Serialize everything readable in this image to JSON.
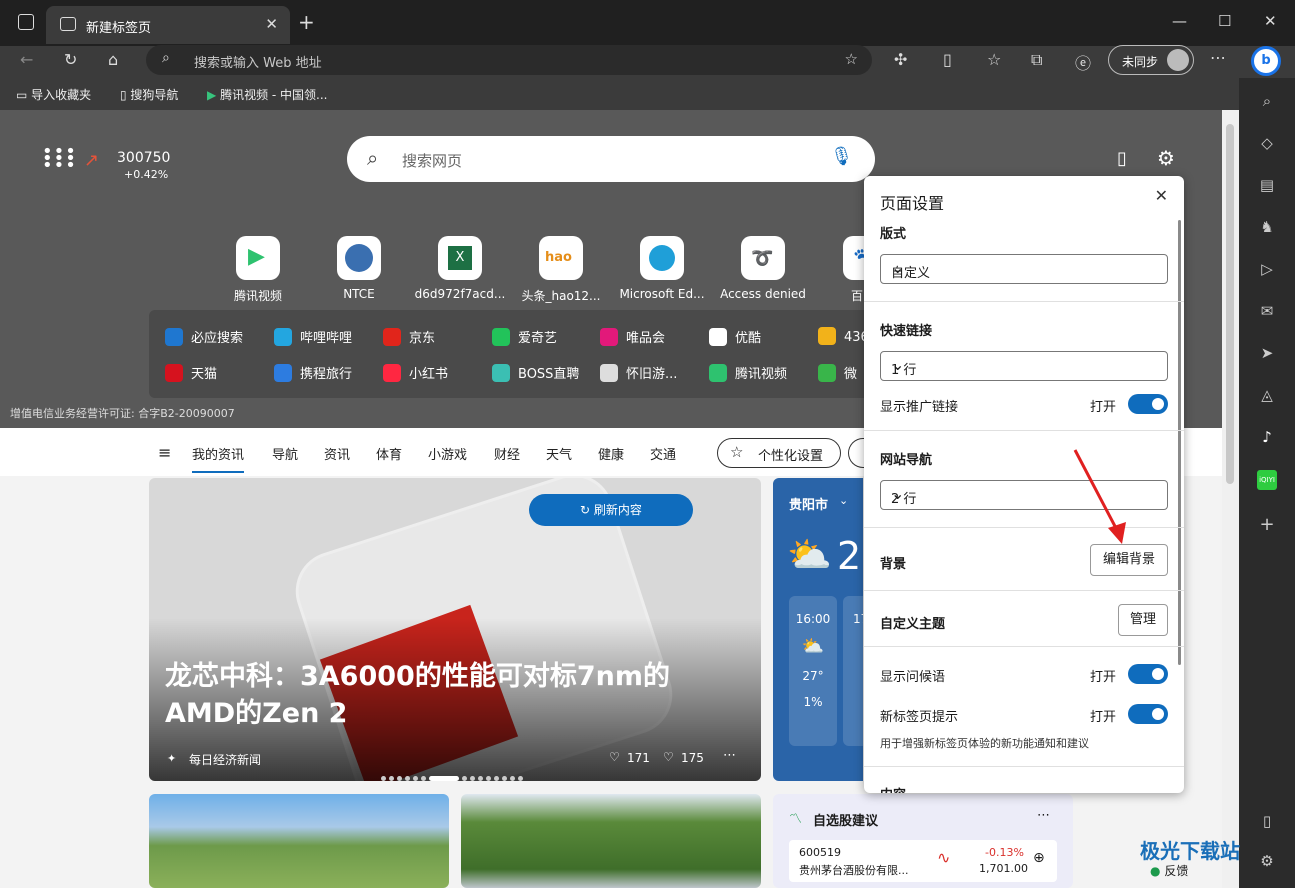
{
  "browser": {
    "tab_title": "新建标签页",
    "address_placeholder": "搜索或输入 Web 地址",
    "sync_label": "未同步",
    "bookmarks": [
      "导入收藏夹",
      "搜狗导航",
      "腾讯视频 - 中国领..."
    ]
  },
  "newtab": {
    "stock_value": "300750",
    "stock_change": "+0.42%",
    "search_placeholder": "搜索网页",
    "tiles": [
      "腾讯视频",
      "NTCE",
      "d6d972f7acd...",
      "头条_hao12...",
      "Microsoft Ed...",
      "Access denied",
      "百"
    ],
    "quick_links_row1": [
      "必应搜索",
      "哔哩哔哩",
      "京东",
      "爱奇艺",
      "唯品会",
      "优酷",
      "436"
    ],
    "quick_links_row2": [
      "天猫",
      "携程旅行",
      "小红书",
      "BOSS直聘",
      "怀旧游...",
      "腾讯视频",
      "微"
    ],
    "license": "增值电信业务经营许可证: 合字B2-20090007",
    "nav_items": [
      "我的资讯",
      "导航",
      "资讯",
      "体育",
      "小游戏",
      "财经",
      "天气",
      "健康",
      "交通"
    ],
    "personalize": "个性化设置",
    "refresh": "刷新内容",
    "headline": "龙芯中科：3A6000的性能可对标7nm的AMD的Zen 2",
    "source": "每日经济新闻",
    "likes": "171",
    "dislikes": "175",
    "weather_city": "贵阳市",
    "weather_temp": "2",
    "weather_time1": "16:00",
    "weather_time2": "17",
    "weather_t1": "27°",
    "weather_p1": "1%",
    "stock_card_title": "自选股建议",
    "stock_code": "600519",
    "stock_name": "贵州茅台酒股份有限...",
    "stock_pct": "-0.13%",
    "stock_price": "1,701.00",
    "feedback": "反馈"
  },
  "panel": {
    "title": "页面设置",
    "layout_label": "版式",
    "layout_value": "自定义",
    "quicklinks_label": "快速链接",
    "quicklinks_value": "1 行",
    "promo_label": "显示推广链接",
    "on": "打开",
    "sitenav_label": "网站导航",
    "sitenav_value": "2 行",
    "bg_label": "背景",
    "bg_button": "编辑背景",
    "theme_label": "自定义主题",
    "theme_button": "管理",
    "greeting_label": "显示问候语",
    "tips_label": "新标签页提示",
    "tips_note": "用于增强新标签页体验的新功能通知和建议",
    "content_label": "内容"
  },
  "watermark": "极光下载站"
}
